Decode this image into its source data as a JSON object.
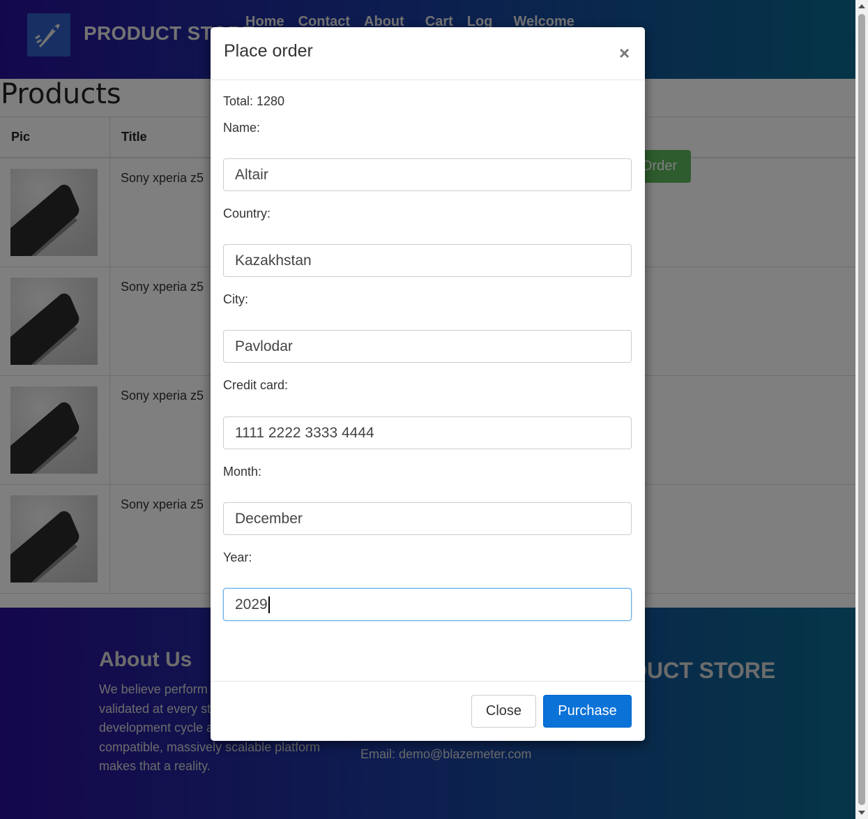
{
  "navbar": {
    "brand": "PRODUCT STORE",
    "links": [
      "Home",
      "Contact",
      "About",
      "Cart",
      "Log",
      "Welcome"
    ]
  },
  "products": {
    "title": "Products",
    "columns": [
      "Pic",
      "Title"
    ],
    "rows": [
      {
        "title": "Sony xperia z5"
      },
      {
        "title": "Sony xperia z5"
      },
      {
        "title": "Sony xperia z5"
      },
      {
        "title": "Sony xperia z5"
      }
    ],
    "place_order_label": "Order"
  },
  "footer": {
    "about_title": "About Us",
    "about_lines": [
      "We believe perform",
      "validated at every st",
      "development cycle a",
      "compatible, massively scalable platform",
      "makes that a reality."
    ],
    "email": "Email: demo@blazemeter.com",
    "brand": "ODUCT STORE"
  },
  "modal": {
    "title": "Place order",
    "close_symbol": "×",
    "total": "Total: 1280",
    "fields": {
      "name": {
        "label": "Name:",
        "value": "Altair"
      },
      "country": {
        "label": "Country:",
        "value": "Kazakhstan"
      },
      "city": {
        "label": "City:",
        "value": "Pavlodar"
      },
      "card": {
        "label": "Credit card:",
        "value": "1111 2222 3333 4444"
      },
      "month": {
        "label": "Month:",
        "value": "December"
      },
      "year": {
        "label": "Year:",
        "value": "2029"
      }
    },
    "close_label": "Close",
    "purchase_label": "Purchase"
  }
}
